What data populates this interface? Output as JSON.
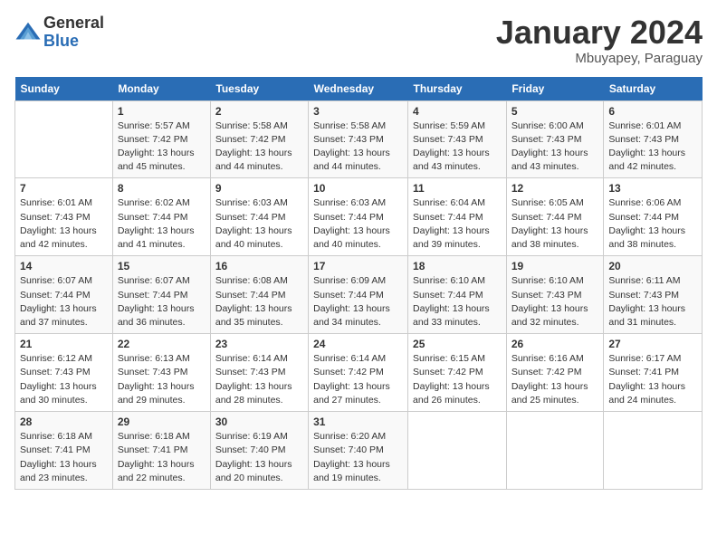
{
  "logo": {
    "general": "General",
    "blue": "Blue"
  },
  "title": "January 2024",
  "location": "Mbuyapey, Paraguay",
  "days_of_week": [
    "Sunday",
    "Monday",
    "Tuesday",
    "Wednesday",
    "Thursday",
    "Friday",
    "Saturday"
  ],
  "weeks": [
    [
      {
        "day": "",
        "sunrise": "",
        "sunset": "",
        "daylight": ""
      },
      {
        "day": "1",
        "sunrise": "Sunrise: 5:57 AM",
        "sunset": "Sunset: 7:42 PM",
        "daylight": "Daylight: 13 hours and 45 minutes."
      },
      {
        "day": "2",
        "sunrise": "Sunrise: 5:58 AM",
        "sunset": "Sunset: 7:42 PM",
        "daylight": "Daylight: 13 hours and 44 minutes."
      },
      {
        "day": "3",
        "sunrise": "Sunrise: 5:58 AM",
        "sunset": "Sunset: 7:43 PM",
        "daylight": "Daylight: 13 hours and 44 minutes."
      },
      {
        "day": "4",
        "sunrise": "Sunrise: 5:59 AM",
        "sunset": "Sunset: 7:43 PM",
        "daylight": "Daylight: 13 hours and 43 minutes."
      },
      {
        "day": "5",
        "sunrise": "Sunrise: 6:00 AM",
        "sunset": "Sunset: 7:43 PM",
        "daylight": "Daylight: 13 hours and 43 minutes."
      },
      {
        "day": "6",
        "sunrise": "Sunrise: 6:01 AM",
        "sunset": "Sunset: 7:43 PM",
        "daylight": "Daylight: 13 hours and 42 minutes."
      }
    ],
    [
      {
        "day": "7",
        "sunrise": "Sunrise: 6:01 AM",
        "sunset": "Sunset: 7:43 PM",
        "daylight": "Daylight: 13 hours and 42 minutes."
      },
      {
        "day": "8",
        "sunrise": "Sunrise: 6:02 AM",
        "sunset": "Sunset: 7:44 PM",
        "daylight": "Daylight: 13 hours and 41 minutes."
      },
      {
        "day": "9",
        "sunrise": "Sunrise: 6:03 AM",
        "sunset": "Sunset: 7:44 PM",
        "daylight": "Daylight: 13 hours and 40 minutes."
      },
      {
        "day": "10",
        "sunrise": "Sunrise: 6:03 AM",
        "sunset": "Sunset: 7:44 PM",
        "daylight": "Daylight: 13 hours and 40 minutes."
      },
      {
        "day": "11",
        "sunrise": "Sunrise: 6:04 AM",
        "sunset": "Sunset: 7:44 PM",
        "daylight": "Daylight: 13 hours and 39 minutes."
      },
      {
        "day": "12",
        "sunrise": "Sunrise: 6:05 AM",
        "sunset": "Sunset: 7:44 PM",
        "daylight": "Daylight: 13 hours and 38 minutes."
      },
      {
        "day": "13",
        "sunrise": "Sunrise: 6:06 AM",
        "sunset": "Sunset: 7:44 PM",
        "daylight": "Daylight: 13 hours and 38 minutes."
      }
    ],
    [
      {
        "day": "14",
        "sunrise": "Sunrise: 6:07 AM",
        "sunset": "Sunset: 7:44 PM",
        "daylight": "Daylight: 13 hours and 37 minutes."
      },
      {
        "day": "15",
        "sunrise": "Sunrise: 6:07 AM",
        "sunset": "Sunset: 7:44 PM",
        "daylight": "Daylight: 13 hours and 36 minutes."
      },
      {
        "day": "16",
        "sunrise": "Sunrise: 6:08 AM",
        "sunset": "Sunset: 7:44 PM",
        "daylight": "Daylight: 13 hours and 35 minutes."
      },
      {
        "day": "17",
        "sunrise": "Sunrise: 6:09 AM",
        "sunset": "Sunset: 7:44 PM",
        "daylight": "Daylight: 13 hours and 34 minutes."
      },
      {
        "day": "18",
        "sunrise": "Sunrise: 6:10 AM",
        "sunset": "Sunset: 7:44 PM",
        "daylight": "Daylight: 13 hours and 33 minutes."
      },
      {
        "day": "19",
        "sunrise": "Sunrise: 6:10 AM",
        "sunset": "Sunset: 7:43 PM",
        "daylight": "Daylight: 13 hours and 32 minutes."
      },
      {
        "day": "20",
        "sunrise": "Sunrise: 6:11 AM",
        "sunset": "Sunset: 7:43 PM",
        "daylight": "Daylight: 13 hours and 31 minutes."
      }
    ],
    [
      {
        "day": "21",
        "sunrise": "Sunrise: 6:12 AM",
        "sunset": "Sunset: 7:43 PM",
        "daylight": "Daylight: 13 hours and 30 minutes."
      },
      {
        "day": "22",
        "sunrise": "Sunrise: 6:13 AM",
        "sunset": "Sunset: 7:43 PM",
        "daylight": "Daylight: 13 hours and 29 minutes."
      },
      {
        "day": "23",
        "sunrise": "Sunrise: 6:14 AM",
        "sunset": "Sunset: 7:43 PM",
        "daylight": "Daylight: 13 hours and 28 minutes."
      },
      {
        "day": "24",
        "sunrise": "Sunrise: 6:14 AM",
        "sunset": "Sunset: 7:42 PM",
        "daylight": "Daylight: 13 hours and 27 minutes."
      },
      {
        "day": "25",
        "sunrise": "Sunrise: 6:15 AM",
        "sunset": "Sunset: 7:42 PM",
        "daylight": "Daylight: 13 hours and 26 minutes."
      },
      {
        "day": "26",
        "sunrise": "Sunrise: 6:16 AM",
        "sunset": "Sunset: 7:42 PM",
        "daylight": "Daylight: 13 hours and 25 minutes."
      },
      {
        "day": "27",
        "sunrise": "Sunrise: 6:17 AM",
        "sunset": "Sunset: 7:41 PM",
        "daylight": "Daylight: 13 hours and 24 minutes."
      }
    ],
    [
      {
        "day": "28",
        "sunrise": "Sunrise: 6:18 AM",
        "sunset": "Sunset: 7:41 PM",
        "daylight": "Daylight: 13 hours and 23 minutes."
      },
      {
        "day": "29",
        "sunrise": "Sunrise: 6:18 AM",
        "sunset": "Sunset: 7:41 PM",
        "daylight": "Daylight: 13 hours and 22 minutes."
      },
      {
        "day": "30",
        "sunrise": "Sunrise: 6:19 AM",
        "sunset": "Sunset: 7:40 PM",
        "daylight": "Daylight: 13 hours and 20 minutes."
      },
      {
        "day": "31",
        "sunrise": "Sunrise: 6:20 AM",
        "sunset": "Sunset: 7:40 PM",
        "daylight": "Daylight: 13 hours and 19 minutes."
      },
      {
        "day": "",
        "sunrise": "",
        "sunset": "",
        "daylight": ""
      },
      {
        "day": "",
        "sunrise": "",
        "sunset": "",
        "daylight": ""
      },
      {
        "day": "",
        "sunrise": "",
        "sunset": "",
        "daylight": ""
      }
    ]
  ]
}
